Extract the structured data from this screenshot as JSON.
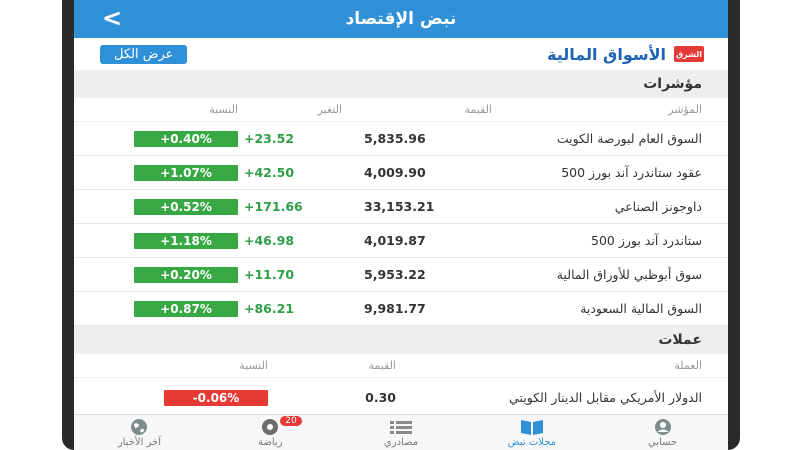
{
  "appbar": {
    "title": "نبض الإقتصاد",
    "back_glyph": "<"
  },
  "markets": {
    "brand_logo": "الشرق",
    "title": "الأسواق المالية",
    "view_all": "عرض الكل"
  },
  "indices": {
    "title": "مؤشرات",
    "columns": {
      "name": "المؤشر",
      "value": "القيمة",
      "change": "التغير",
      "percent": "النسبة"
    },
    "rows": [
      {
        "name": "السوق العام لبورصة الكويت",
        "value": "5,835.96",
        "change": "+23.52",
        "percent": "+0.40%"
      },
      {
        "name": "عقود ستاندرد آند بورز 500",
        "value": "4,009.90",
        "change": "+42.50",
        "percent": "+1.07%"
      },
      {
        "name": "داوجونز الصناعي",
        "value": "33,153.21",
        "change": "+171.66",
        "percent": "+0.52%"
      },
      {
        "name": "ستاندرد آند بورز 500",
        "value": "4,019.87",
        "change": "+46.98",
        "percent": "+1.18%"
      },
      {
        "name": "سوق أبوظبي للأوراق المالية",
        "value": "5,953.22",
        "change": "+11.70",
        "percent": "+0.20%"
      },
      {
        "name": "السوق المالية السعودية",
        "value": "9,981.77",
        "change": "+86.21",
        "percent": "+0.87%"
      }
    ]
  },
  "currencies": {
    "title": "عملات",
    "columns": {
      "name": "العملة",
      "value": "القيمة",
      "percent": "النسبة"
    },
    "rows": [
      {
        "name": "الدولار الأمريكي مقابل الدينار الكويتي",
        "value": "0.30",
        "percent": "-0.06%"
      }
    ]
  },
  "tabs": [
    {
      "label": "حسابي",
      "icon": "user-icon"
    },
    {
      "label": "مجلات نبض",
      "icon": "book-icon"
    },
    {
      "label": "مصادري",
      "icon": "list-icon"
    },
    {
      "label": "رياضة",
      "icon": "football-icon",
      "badge": "20"
    },
    {
      "label": "آخر الأخبار",
      "icon": "globe-icon"
    }
  ],
  "colors": {
    "accent": "#2f8fd7",
    "positive": "#38a845",
    "negative": "#e53935",
    "brand": "#1e63b5"
  }
}
